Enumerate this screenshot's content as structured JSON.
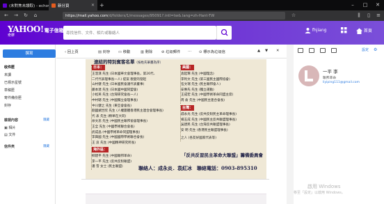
{
  "browser": {
    "tabs": [
      {
        "label": "(未對焦未讀取) - echowuhc@..."
      },
      {
        "label": "新分頁"
      }
    ],
    "new_tab": "+",
    "url_host": "https://mail.yahoo.com",
    "url_rest": "/d/folders/1/messages/95091?.intl=tw&.lang=zh-Hant-TW"
  },
  "yahoo": {
    "logo": "YAHOO!",
    "logo_zh": "電子信箱",
    "logo_sub": "奇摩",
    "search_placeholder": "尋找信件、文件、相片或聯絡人",
    "user": "fhjiang",
    "home_label": "首頁"
  },
  "sidebar": {
    "compose": "撰寫",
    "folders": [
      "收件匣",
      "未讀",
      "已標示星號",
      "草稿匣",
      "寄件備份匣",
      "封存"
    ],
    "views_title": "檢視內容",
    "views_action": "隱藏",
    "views": [
      "相片",
      "文件"
    ],
    "folders_title": "信件夾",
    "folders_action": "隱藏"
  },
  "toolbar": {
    "back": "‹ 回上頁",
    "archive": "封存",
    "move": "移動",
    "delete": "刪除",
    "spam": "垃圾郵件",
    "more": "…",
    "mark_spam": "標示為垃圾信"
  },
  "poster": {
    "title": "連結的特別賓客名單",
    "title_note": "（按姓氏筆畫為序）",
    "section_japan": "日本：",
    "japan_lines": [
      "王澄漢 先生 (日本國華文會理事長，第26代、",
      "二代代表理事長一人) 提案 親愛的發起",
      "山村健 先生 (日本國民會議代表董事)",
      "藤本達 先生 (日本國中國同盟會)",
      "小松英 先生 (台灣研究會長一人)",
      "中村聰 先生 (中國獨立會理事長)",
      "中川健之 先生 (東亞會會長)",
      "劉國斌世欣 先生 (人權團體香港民主連合會理事長)",
      "代 表 先生 (精華在大同)",
      "徐文思 先生 (中國民主聯邦協會理事長)",
      "王全 先生 (中國學術聯合會長)",
      "武成晶 (中國學術革命同盟理事長)",
      "李興國 先生 (中國國際學術聯合會長)",
      "王 良 先生 (中國精神研究所長)"
    ],
    "section_usa": "美國：",
    "usa_lines": [
      "袁起琢 先生 (中國理念)",
      "李利文 先生 (第三國民主國際協會)",
      "伍文瑞 先生 (民主聯邦會人)",
      "安惠先 先生 (獨立運動)",
      "王成宏 先生 (中國學術革命同盟主席)",
      "周 侖 先生 (中國民主連合會長)"
    ],
    "section_hk": "台灣：",
    "hk_lines": [
      "戚永光 先生 (反共反對民主革命理事長)",
      "楊玉成 先生 (中國民主反共聯盟理事長)",
      "吳建民 先生 (台灣反共聯盟理事長)",
      "安 明 先生 (香港民主聯盟理事長)"
    ],
    "section_other": "海外區：",
    "other_lines": [
      "柳建平 先生 (中國聯邦革命)",
      "李一平 先生 (反共反對聯盟)",
      "潘 雪 女士 (民主聯盟)"
    ],
    "note_line": "之人 (各友好國家代表等)",
    "banner": "「反共反習民主革命大聯盟」籌備委員會",
    "contact1": "聯絡人：成永炎．袁紅冰",
    "contact2": "聯絡電話：0903-895310"
  },
  "contact_card": {
    "name": "一平 李",
    "role": "聯邦革命",
    "email": "liyiping111@gmail.com"
  },
  "right_panel": {
    "settings": "設定"
  },
  "watermark": {
    "line1": "啟用 Windows",
    "line2": "移至「設定」以啟用 Windows。"
  },
  "colors": {
    "yahoo_purple": "#5f01d1",
    "compose_blue": "#2e7de0",
    "poster_bg": "#efe8d6",
    "poster_header_red": "#b72525"
  }
}
